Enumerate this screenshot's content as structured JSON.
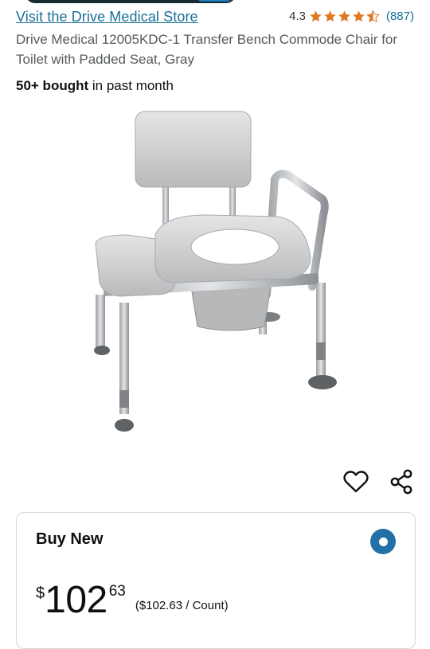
{
  "store": {
    "link_text": "Visit the Drive Medical Store"
  },
  "rating": {
    "value": "4.3",
    "stars": 4.3,
    "count": "(887)",
    "star_color": "#de7921"
  },
  "product": {
    "title": "Drive Medical 12005KDC-1 Transfer Bench Commode Chair for Toilet with Padded Seat, Gray",
    "bought_bold": "50+ bought",
    "bought_rest": " in past month",
    "image_icon": "transfer-bench-commode-image"
  },
  "actions": {
    "wishlist_icon": "heart-icon",
    "share_icon": "share-icon"
  },
  "buy_box": {
    "label": "Buy New",
    "selected": true,
    "price_symbol": "$",
    "price_whole": "102",
    "price_fraction": "63",
    "unit_price": "($102.63 / Count)",
    "radio_color": "#236fa8"
  },
  "colors": {
    "link": "#1a6f97",
    "text": "#0f1111",
    "muted": "#555a5a"
  }
}
